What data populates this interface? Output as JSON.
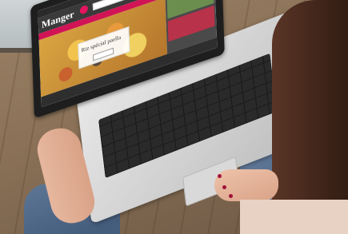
{
  "photo": {
    "description_subject": "laptop-on-lap",
    "screen": {
      "logo_text": "Manger",
      "hero_title": "Riz spécial paella",
      "hero_button": "",
      "nav_items": [
        "",
        "",
        "",
        "",
        "",
        ""
      ],
      "side_promo": "",
      "footer_items": [
        "",
        "",
        ""
      ]
    }
  },
  "colors": {
    "brand_pink": "#e5145f",
    "nav_pink": "#d11456",
    "screen_dark": "#3a3a3a"
  }
}
